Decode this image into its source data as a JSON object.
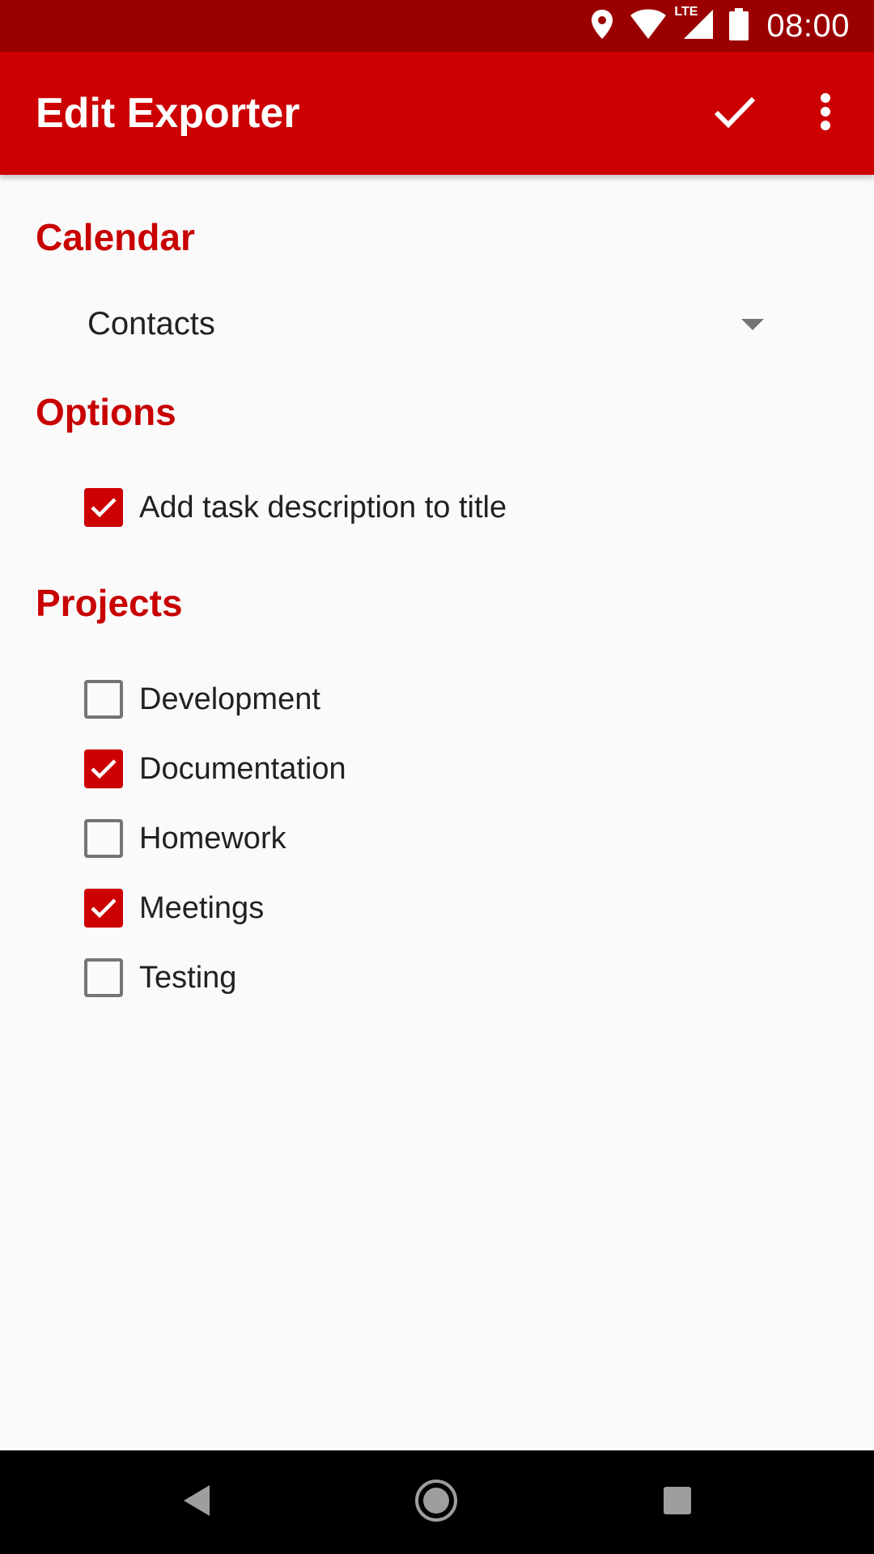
{
  "status_bar": {
    "time": "08:00",
    "icons": [
      "location-icon",
      "wifi-icon",
      "lte-signal-icon",
      "battery-icon"
    ],
    "network_label": "LTE"
  },
  "app_bar": {
    "title": "Edit Exporter",
    "actions": [
      "check-icon",
      "more-vert-icon"
    ]
  },
  "sections": {
    "calendar": {
      "header": "Calendar",
      "spinner_value": "Contacts"
    },
    "options": {
      "header": "Options",
      "items": [
        {
          "label": "Add task description to title",
          "checked": true
        }
      ]
    },
    "projects": {
      "header": "Projects",
      "items": [
        {
          "label": "Development",
          "checked": false
        },
        {
          "label": "Documentation",
          "checked": true
        },
        {
          "label": "Homework",
          "checked": false
        },
        {
          "label": "Meetings",
          "checked": true
        },
        {
          "label": "Testing",
          "checked": false
        }
      ]
    }
  },
  "nav_bar": {
    "buttons": [
      "back-icon",
      "home-icon",
      "recents-icon"
    ]
  },
  "colors": {
    "primary": "#cc0000",
    "primary_dark": "#9b0000",
    "accent": "#c80000",
    "background": "#fafafa",
    "unchecked_border": "#757575"
  }
}
